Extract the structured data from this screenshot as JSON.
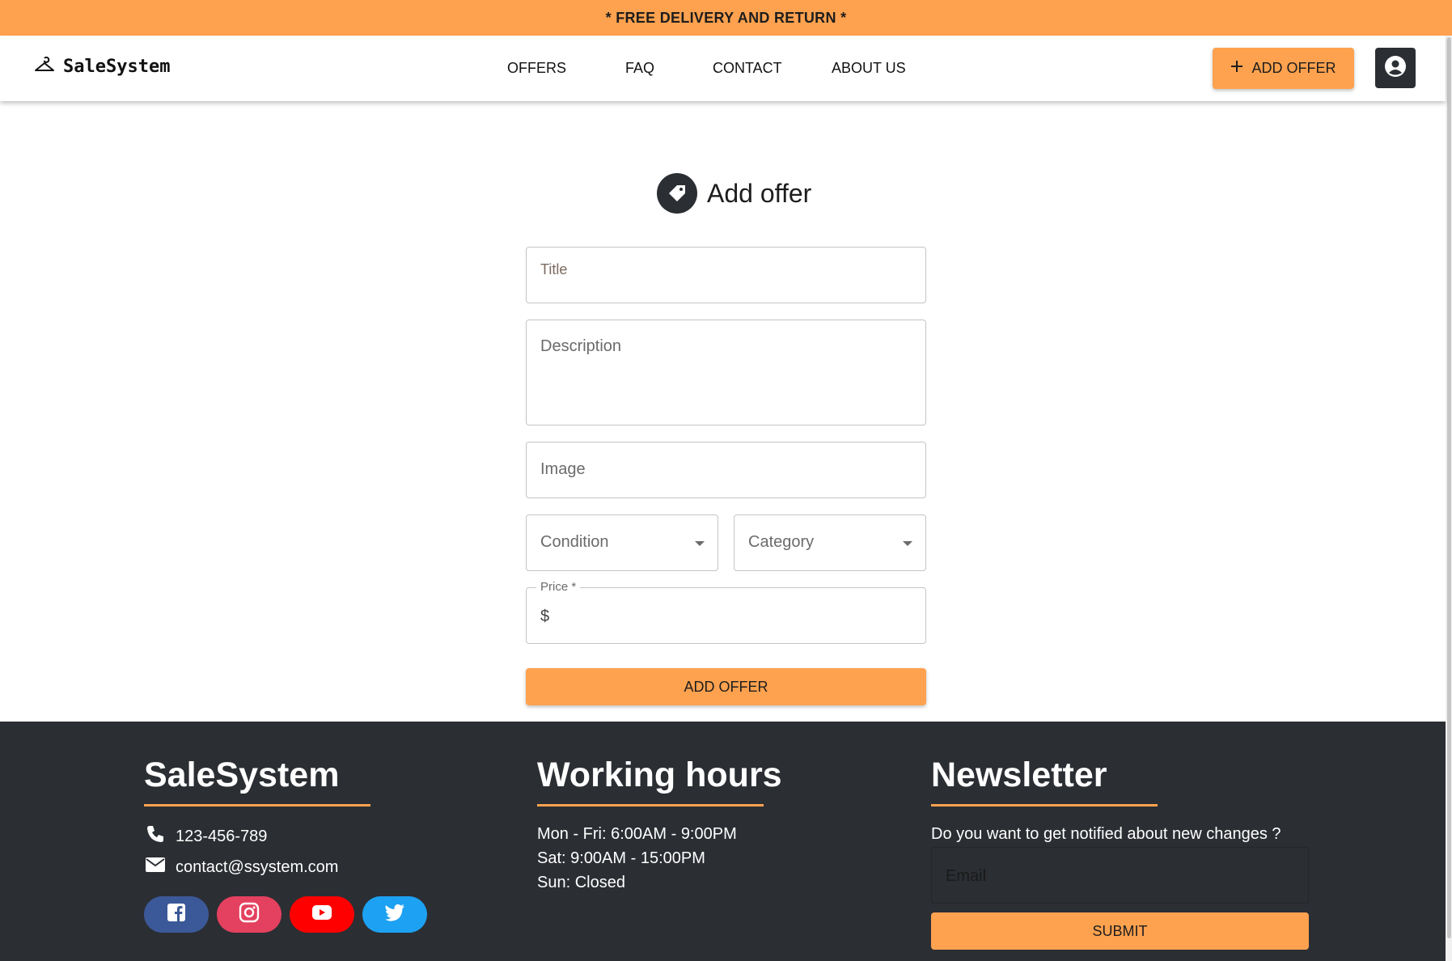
{
  "banner": {
    "text": "* FREE DELIVERY AND RETURN *"
  },
  "header": {
    "logo": "SaleSystem",
    "nav": [
      "OFFERS",
      "FAQ",
      "CONTACT",
      "ABOUT US"
    ],
    "add_offer_label": "ADD OFFER"
  },
  "form": {
    "heading": "Add offer",
    "title_placeholder": "Title",
    "description_placeholder": "Description",
    "image_placeholder": "Image",
    "condition_placeholder": "Condition",
    "category_placeholder": "Category",
    "price_label": "Price *",
    "price_prefix": "$",
    "submit_label": "ADD OFFER"
  },
  "footer": {
    "brand": {
      "title": "SaleSystem",
      "phone": "123-456-789",
      "email": "contact@ssystem.com",
      "socials": [
        "facebook-icon",
        "instagram-icon",
        "youtube-icon",
        "twitter-icon"
      ]
    },
    "hours": {
      "title": "Working hours",
      "lines": [
        "Mon - Fri: 6:00AM - 9:00PM",
        "Sat: 9:00AM - 15:00PM",
        "Sun: Closed"
      ]
    },
    "newsletter": {
      "title": "Newsletter",
      "question": "Do you want to get notified about new changes ?",
      "email_placeholder": "Email",
      "submit_label": "SUBMIT"
    }
  },
  "colors": {
    "accent": "#ffa24f",
    "dark": "#2b2e33",
    "facebook": "#3b5998",
    "instagram": "#e4405f",
    "youtube": "#ff0000",
    "twitter": "#1da1f2"
  }
}
